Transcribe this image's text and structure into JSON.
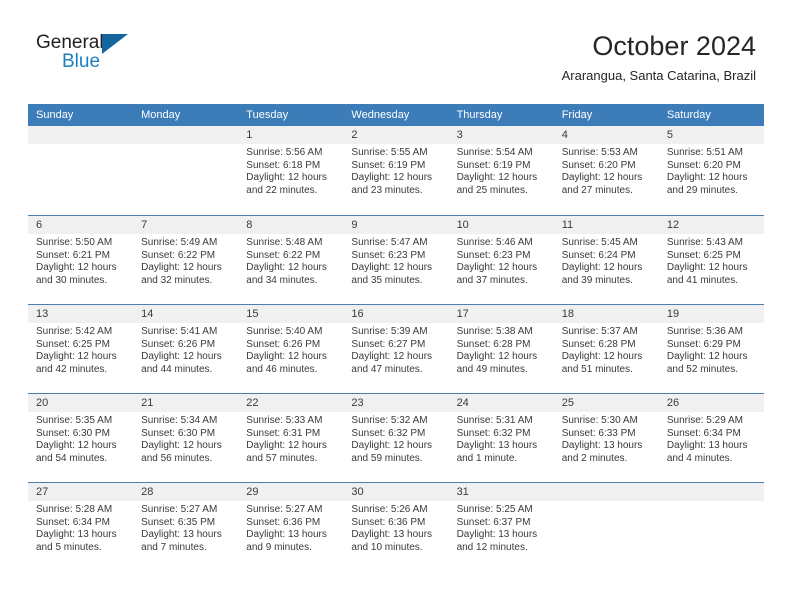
{
  "brand": {
    "name_top": "General",
    "name_bottom": "Blue",
    "accent_color": "#1b7fc3",
    "triangle_color": "#15659f",
    "triangle_icon": "triangle-icon"
  },
  "header": {
    "title": "October 2024",
    "subtitle": "Ararangua, Santa Catarina, Brazil"
  },
  "calendar": {
    "header_bg": "#3c7cb8",
    "header_text_color": "#ffffff",
    "cell_head_bg": "#f0f0f0",
    "row_divider_color": "#4a7fae",
    "weekdays": [
      "Sunday",
      "Monday",
      "Tuesday",
      "Wednesday",
      "Thursday",
      "Friday",
      "Saturday"
    ],
    "weeks": [
      [
        {
          "day": "",
          "lines": []
        },
        {
          "day": "",
          "lines": []
        },
        {
          "day": "1",
          "lines": [
            "Sunrise: 5:56 AM",
            "Sunset: 6:18 PM",
            "Daylight: 12 hours",
            "and 22 minutes."
          ]
        },
        {
          "day": "2",
          "lines": [
            "Sunrise: 5:55 AM",
            "Sunset: 6:19 PM",
            "Daylight: 12 hours",
            "and 23 minutes."
          ]
        },
        {
          "day": "3",
          "lines": [
            "Sunrise: 5:54 AM",
            "Sunset: 6:19 PM",
            "Daylight: 12 hours",
            "and 25 minutes."
          ]
        },
        {
          "day": "4",
          "lines": [
            "Sunrise: 5:53 AM",
            "Sunset: 6:20 PM",
            "Daylight: 12 hours",
            "and 27 minutes."
          ]
        },
        {
          "day": "5",
          "lines": [
            "Sunrise: 5:51 AM",
            "Sunset: 6:20 PM",
            "Daylight: 12 hours",
            "and 29 minutes."
          ]
        }
      ],
      [
        {
          "day": "6",
          "lines": [
            "Sunrise: 5:50 AM",
            "Sunset: 6:21 PM",
            "Daylight: 12 hours",
            "and 30 minutes."
          ]
        },
        {
          "day": "7",
          "lines": [
            "Sunrise: 5:49 AM",
            "Sunset: 6:22 PM",
            "Daylight: 12 hours",
            "and 32 minutes."
          ]
        },
        {
          "day": "8",
          "lines": [
            "Sunrise: 5:48 AM",
            "Sunset: 6:22 PM",
            "Daylight: 12 hours",
            "and 34 minutes."
          ]
        },
        {
          "day": "9",
          "lines": [
            "Sunrise: 5:47 AM",
            "Sunset: 6:23 PM",
            "Daylight: 12 hours",
            "and 35 minutes."
          ]
        },
        {
          "day": "10",
          "lines": [
            "Sunrise: 5:46 AM",
            "Sunset: 6:23 PM",
            "Daylight: 12 hours",
            "and 37 minutes."
          ]
        },
        {
          "day": "11",
          "lines": [
            "Sunrise: 5:45 AM",
            "Sunset: 6:24 PM",
            "Daylight: 12 hours",
            "and 39 minutes."
          ]
        },
        {
          "day": "12",
          "lines": [
            "Sunrise: 5:43 AM",
            "Sunset: 6:25 PM",
            "Daylight: 12 hours",
            "and 41 minutes."
          ]
        }
      ],
      [
        {
          "day": "13",
          "lines": [
            "Sunrise: 5:42 AM",
            "Sunset: 6:25 PM",
            "Daylight: 12 hours",
            "and 42 minutes."
          ]
        },
        {
          "day": "14",
          "lines": [
            "Sunrise: 5:41 AM",
            "Sunset: 6:26 PM",
            "Daylight: 12 hours",
            "and 44 minutes."
          ]
        },
        {
          "day": "15",
          "lines": [
            "Sunrise: 5:40 AM",
            "Sunset: 6:26 PM",
            "Daylight: 12 hours",
            "and 46 minutes."
          ]
        },
        {
          "day": "16",
          "lines": [
            "Sunrise: 5:39 AM",
            "Sunset: 6:27 PM",
            "Daylight: 12 hours",
            "and 47 minutes."
          ]
        },
        {
          "day": "17",
          "lines": [
            "Sunrise: 5:38 AM",
            "Sunset: 6:28 PM",
            "Daylight: 12 hours",
            "and 49 minutes."
          ]
        },
        {
          "day": "18",
          "lines": [
            "Sunrise: 5:37 AM",
            "Sunset: 6:28 PM",
            "Daylight: 12 hours",
            "and 51 minutes."
          ]
        },
        {
          "day": "19",
          "lines": [
            "Sunrise: 5:36 AM",
            "Sunset: 6:29 PM",
            "Daylight: 12 hours",
            "and 52 minutes."
          ]
        }
      ],
      [
        {
          "day": "20",
          "lines": [
            "Sunrise: 5:35 AM",
            "Sunset: 6:30 PM",
            "Daylight: 12 hours",
            "and 54 minutes."
          ]
        },
        {
          "day": "21",
          "lines": [
            "Sunrise: 5:34 AM",
            "Sunset: 6:30 PM",
            "Daylight: 12 hours",
            "and 56 minutes."
          ]
        },
        {
          "day": "22",
          "lines": [
            "Sunrise: 5:33 AM",
            "Sunset: 6:31 PM",
            "Daylight: 12 hours",
            "and 57 minutes."
          ]
        },
        {
          "day": "23",
          "lines": [
            "Sunrise: 5:32 AM",
            "Sunset: 6:32 PM",
            "Daylight: 12 hours",
            "and 59 minutes."
          ]
        },
        {
          "day": "24",
          "lines": [
            "Sunrise: 5:31 AM",
            "Sunset: 6:32 PM",
            "Daylight: 13 hours",
            "and 1 minute."
          ]
        },
        {
          "day": "25",
          "lines": [
            "Sunrise: 5:30 AM",
            "Sunset: 6:33 PM",
            "Daylight: 13 hours",
            "and 2 minutes."
          ]
        },
        {
          "day": "26",
          "lines": [
            "Sunrise: 5:29 AM",
            "Sunset: 6:34 PM",
            "Daylight: 13 hours",
            "and 4 minutes."
          ]
        }
      ],
      [
        {
          "day": "27",
          "lines": [
            "Sunrise: 5:28 AM",
            "Sunset: 6:34 PM",
            "Daylight: 13 hours",
            "and 5 minutes."
          ]
        },
        {
          "day": "28",
          "lines": [
            "Sunrise: 5:27 AM",
            "Sunset: 6:35 PM",
            "Daylight: 13 hours",
            "and 7 minutes."
          ]
        },
        {
          "day": "29",
          "lines": [
            "Sunrise: 5:27 AM",
            "Sunset: 6:36 PM",
            "Daylight: 13 hours",
            "and 9 minutes."
          ]
        },
        {
          "day": "30",
          "lines": [
            "Sunrise: 5:26 AM",
            "Sunset: 6:36 PM",
            "Daylight: 13 hours",
            "and 10 minutes."
          ]
        },
        {
          "day": "31",
          "lines": [
            "Sunrise: 5:25 AM",
            "Sunset: 6:37 PM",
            "Daylight: 13 hours",
            "and 12 minutes."
          ]
        },
        {
          "day": "",
          "lines": []
        },
        {
          "day": "",
          "lines": []
        }
      ]
    ]
  }
}
